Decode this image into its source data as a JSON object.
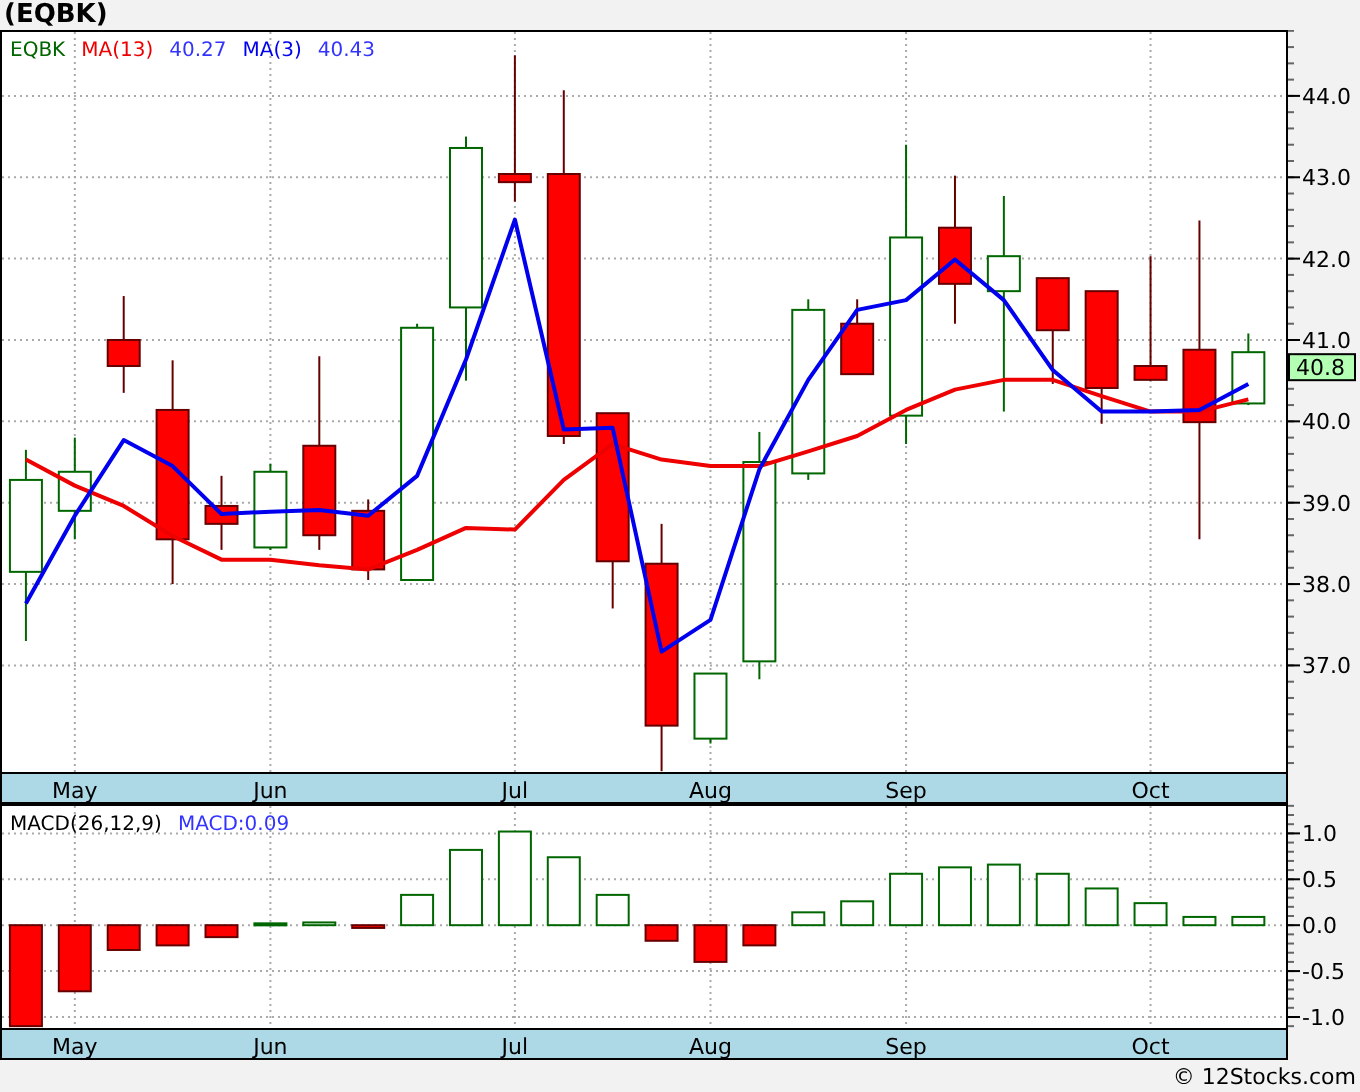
{
  "title": "(EQBK)",
  "price_chart": {
    "symbol": "EQBK",
    "ma_values": [
      "40.27",
      "40.43"
    ],
    "last_price_label": "40.8",
    "moving_averages": {
      "chart_data": {
        "type": "line",
        "grid": true,
        "ylim": [
          35.69,
          44.81
        ],
        "categories": [
          null,
          "May",
          null,
          null,
          null,
          "Jun",
          null,
          null,
          null,
          null,
          "Jul",
          null,
          null,
          null,
          "Aug",
          null,
          null,
          null,
          "Sep",
          null,
          null,
          null,
          null,
          "Oct",
          null,
          null
        ],
        "yticks": [
          {
            "value": 37,
            "label": "37.0"
          },
          {
            "value": 38,
            "label": "38.0"
          },
          {
            "value": 39,
            "label": "39.0"
          },
          {
            "value": 40,
            "label": "40.0"
          },
          {
            "value": 41,
            "label": "41.0"
          },
          {
            "value": 42,
            "label": "42.0"
          },
          {
            "value": 43,
            "label": "43.0"
          },
          {
            "value": 44,
            "label": "44.0"
          }
        ],
        "series": [
          {
            "name": "MA(13)",
            "color": "#ee0000",
            "values": [
              39.53,
              39.21,
              38.96,
              38.59,
              38.3,
              38.3,
              38.23,
              38.18,
              38.42,
              38.69,
              38.67,
              39.28,
              39.72,
              39.53,
              39.45,
              39.45,
              39.63,
              39.82,
              40.14,
              40.39,
              40.51,
              40.51,
              40.31,
              40.12,
              40.12,
              40.27
            ]
          },
          {
            "name": "MA(3)",
            "color": "#0000ee",
            "values": [
              37.76,
              38.84,
              39.77,
              39.45,
              38.86,
              38.89,
              38.91,
              38.84,
              39.33,
              40.76,
              42.48,
              39.9,
              39.92,
              37.17,
              37.56,
              39.41,
              40.51,
              41.37,
              41.49,
              41.99,
              41.49,
              40.63,
              40.12,
              40.12,
              40.14,
              40.46
            ]
          }
        ]
      }
    },
    "candles": {
      "chart_data": {
        "type": "candlestick",
        "ylim": [
          35.69,
          44.81
        ],
        "ohlc": [
          [
            38.15,
            39.65,
            37.3,
            39.28
          ],
          [
            38.9,
            39.8,
            38.55,
            39.38
          ],
          [
            41.0,
            41.54,
            40.35,
            40.68
          ],
          [
            40.14,
            40.75,
            38.0,
            38.55
          ],
          [
            38.96,
            39.33,
            38.42,
            38.74
          ],
          [
            38.45,
            39.48,
            38.42,
            39.38
          ],
          [
            39.7,
            40.8,
            38.42,
            38.6
          ],
          [
            38.9,
            39.04,
            38.05,
            38.18
          ],
          [
            38.05,
            41.2,
            38.05,
            41.15
          ],
          [
            41.4,
            43.5,
            40.5,
            43.36
          ],
          [
            43.04,
            44.5,
            42.7,
            42.94
          ],
          [
            43.04,
            44.07,
            39.72,
            39.82
          ],
          [
            40.1,
            40.1,
            37.7,
            38.28
          ],
          [
            38.25,
            38.74,
            35.7,
            36.26
          ],
          [
            36.1,
            36.9,
            36.04,
            36.9
          ],
          [
            37.05,
            39.87,
            36.83,
            39.5
          ],
          [
            39.36,
            41.5,
            39.28,
            41.37
          ],
          [
            41.2,
            41.5,
            40.58,
            40.58
          ],
          [
            40.07,
            43.4,
            39.72,
            42.26
          ],
          [
            42.38,
            43.02,
            41.2,
            41.69
          ],
          [
            41.6,
            42.77,
            40.12,
            42.03
          ],
          [
            41.76,
            41.76,
            40.46,
            41.12
          ],
          [
            41.6,
            41.6,
            39.97,
            40.41
          ],
          [
            40.68,
            42.03,
            40.5,
            40.51
          ],
          [
            40.88,
            42.47,
            38.55,
            39.99
          ],
          [
            40.22,
            41.08,
            40.2,
            40.85
          ]
        ]
      }
    }
  },
  "macd_chart": {
    "legend": [
      {
        "text": "MACD(26,12,9)",
        "color": "#000000"
      },
      {
        "text": "MACD:0.09",
        "color": "#3333ff"
      }
    ],
    "chart_data": {
      "type": "bar",
      "grid": true,
      "ylim": [
        -1.12,
        1.32
      ],
      "categories": [
        null,
        "May",
        null,
        null,
        null,
        "Jun",
        null,
        null,
        null,
        null,
        "Jul",
        null,
        null,
        null,
        "Aug",
        null,
        null,
        null,
        "Sep",
        null,
        null,
        null,
        null,
        "Oct",
        null,
        null
      ],
      "yticks": [
        {
          "value": -1,
          "label": "-1.0"
        },
        {
          "value": -0.5,
          "label": "-0.5"
        },
        {
          "value": 0,
          "label": "0.0"
        },
        {
          "value": 0.5,
          "label": "0.5"
        },
        {
          "value": 1,
          "label": "1.0"
        }
      ],
      "values": [
        -1.1,
        -0.72,
        -0.27,
        -0.22,
        -0.13,
        0.02,
        0.03,
        -0.03,
        0.33,
        0.82,
        1.02,
        0.74,
        0.33,
        -0.17,
        -0.4,
        -0.22,
        0.14,
        0.26,
        0.56,
        0.63,
        0.66,
        0.56,
        0.4,
        0.24,
        0.09,
        0.09
      ]
    }
  },
  "copyright": "© 12Stocks.com"
}
